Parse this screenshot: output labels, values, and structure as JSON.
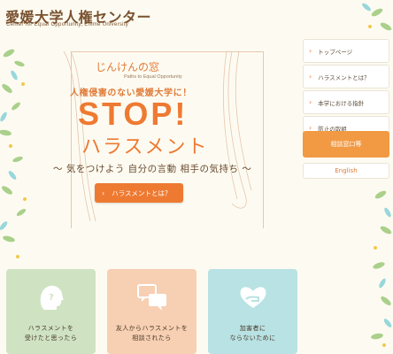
{
  "header": {
    "title": "愛媛大学人権センター",
    "subtitle": "Center for Equal Opportunity, Ehime University"
  },
  "hero": {
    "window_title": "じんけんの窓",
    "window_title_en": "Paths to Equal Opportunity",
    "tagline": "人権侵害のない愛媛大学に！",
    "stop": "STOP!",
    "harassment": "ハラスメント",
    "slogan": "～ 気をつけよう 自分の言動 相手の気持ち ～",
    "cta_label": "ハラスメントとは？"
  },
  "nav": {
    "items": [
      {
        "label": "トップページ"
      },
      {
        "label": "ハラスメントとは？"
      },
      {
        "label": "本学における指針"
      },
      {
        "label": "防止の取組"
      }
    ],
    "consult_label": "相談窓口等",
    "english_label": "English"
  },
  "cards": [
    {
      "line1": "ハラスメントを",
      "line2": "受けたと思ったら",
      "icon": "head-question-icon",
      "color": "#cfe3c3"
    },
    {
      "line1": "友人からハラスメントを",
      "line2": "相談されたら",
      "icon": "speech-bubbles-icon",
      "color": "#f7cfb2"
    },
    {
      "line1": "加害者に",
      "line2": "ならないために",
      "icon": "heart-hand-icon",
      "color": "#b8e2e3"
    }
  ],
  "colors": {
    "accent": "#ee7a32",
    "title_brown": "#7a5230",
    "background": "#fdfbf1"
  }
}
